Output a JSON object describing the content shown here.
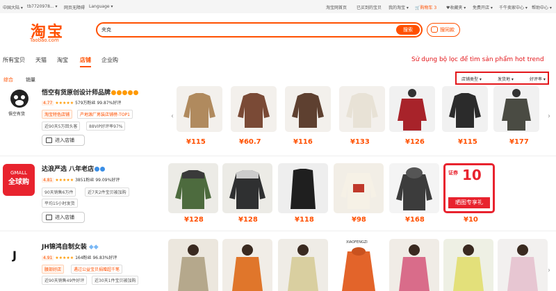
{
  "topbar": {
    "region": "中国大陆 ▾",
    "user": "tb7720978... ▾",
    "accessible": "网页无障碍",
    "language": "Language ▾",
    "home": "淘宝网首页",
    "bought": "已买到的宝贝",
    "my_taobao": "我的淘宝 ▾",
    "cart": "购物车 3",
    "favorites": "收藏夹 ▾",
    "free_open": "免费开店 ▾",
    "seller_center": "千牛卖家中心 ▾",
    "help": "帮助中心 ▾"
  },
  "logo": {
    "text": "淘宝",
    "sub": "Taobao.com"
  },
  "search": {
    "value": "夹克",
    "button": "搜索",
    "image_search": "搜同款"
  },
  "tabs": [
    "所有宝贝",
    "天猫",
    "淘宝",
    "店铺",
    "企业购"
  ],
  "note": "Sử dụng bộ lọc để tìm sản phẩm hot trend",
  "sort": {
    "comprehensive": "综合",
    "sales": "销量"
  },
  "filters": {
    "shop_type": "店铺类型 ▾",
    "ship_from": "发货地 ▾",
    "rating": "好评率 ▾"
  },
  "shops": [
    {
      "name": "悟空有货原创设计师品牌",
      "score": "4.77",
      "fans": "579万粉丝",
      "good": "99.87%好评",
      "tag1": "淘宝特色店铺",
      "tag2": "产地源厂男装店铺榜-TOP1",
      "tag3": "近90天5万回头客",
      "tag4": "88VIP好评率97%",
      "enter": "进入店铺",
      "logo_caption": "悟空有货",
      "prices": [
        "¥115",
        "¥60.7",
        "¥116",
        "¥133",
        "¥126",
        "¥115",
        "¥177"
      ]
    },
    {
      "name": "达浪严选 八年老店",
      "score": "4.81",
      "fans": "3851粉丝",
      "good": "99.09%好评",
      "tag1": "90天销售6万件",
      "tag2": "近7天2件宝贝被加购",
      "tag3": "平均15小时发货",
      "enter": "进入店铺",
      "logo_top": "GMALL",
      "logo_bottom": "全球购",
      "promo_top": "证券",
      "promo_big": "10",
      "promo_bottom": "晒图专享礼",
      "prices": [
        "¥128",
        "¥128",
        "¥118",
        "¥98",
        "¥168",
        "¥10"
      ]
    },
    {
      "name": "JH锦鸿自制女装",
      "score": "4.91",
      "fans": "164粉丝",
      "good": "96.83%好评",
      "tag1": "腰部好店",
      "tag2": "遇过公益宝贝捐赠超千笔",
      "tag3": "近90天销售49件好评",
      "tag4": "近30天1件宝贝被加购",
      "logo": "J",
      "brand_caption": "XIAOFENGZI"
    }
  ],
  "colors": {
    "accent": "#ff5000",
    "annotation": "#e3161a"
  }
}
